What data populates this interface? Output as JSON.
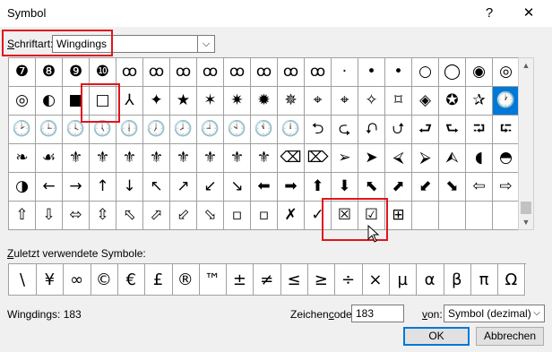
{
  "window": {
    "title": "Symbol",
    "help_label": "?",
    "close_label": "✕"
  },
  "font_row": {
    "label_underlined": "S",
    "label_rest": "chriftart:",
    "value": "Wingdings"
  },
  "grid_rows": [
    [
      "❼",
      "❽",
      "❾",
      "❿",
      "ꝏ",
      "ꝏ",
      "ꝏ",
      "ꝏ",
      "ꝏ",
      "ꝏ",
      "ꝏ",
      "ꝏ",
      "·",
      "•",
      "•",
      "○",
      "◯",
      "◉",
      "◎"
    ],
    [
      "◎",
      "◐",
      "■",
      "□",
      "⅄",
      "✦",
      "★",
      "✶",
      "✷",
      "✹",
      "✵",
      "⌖",
      "⌖",
      "✧",
      "⌑",
      "◈",
      "✪",
      "✰",
      "🕐"
    ],
    [
      "🕑",
      "🕒",
      "🕓",
      "🕔",
      "🕕",
      "🕖",
      "🕗",
      "🕘",
      "🕙",
      "🕚",
      "🕛",
      "⮌",
      "⮎",
      "⮏",
      "⮍",
      "⮐",
      "⮑",
      "⮒",
      "⮓"
    ],
    [
      "❧",
      "☙",
      "⚜",
      "⚜",
      "⚜",
      "⚜",
      "⚜",
      "⚜",
      "⚜",
      "⚜",
      "⌫",
      "⌦",
      "➢",
      "➤",
      "⮘",
      "⮚",
      "⮙",
      "◖",
      "◓"
    ],
    [
      "◑",
      "←",
      "→",
      "↑",
      "↓",
      "↖",
      "↗",
      "↙",
      "↘",
      "⬅",
      "➡",
      "⬆",
      "⬇",
      "⬉",
      "⬈",
      "⬋",
      "⬊",
      "⇦",
      "⇨"
    ],
    [
      "⇧",
      "⇩",
      "⬄",
      "⇳",
      "⬁",
      "⬀",
      "⬃",
      "⬂",
      "▫",
      "▫",
      "✗",
      "✓",
      "☒",
      "☑",
      "⊞",
      "",
      "",
      "",
      ""
    ]
  ],
  "selected_symbol_desc": "clock",
  "recent": {
    "label_underlined": "Z",
    "label_rest": "uletzt verwendete Symbole:",
    "symbols": [
      "\\",
      "¥",
      "∞",
      "©",
      "€",
      "£",
      "®",
      "™",
      "±",
      "≠",
      "≤",
      "≥",
      "÷",
      "×",
      "µ",
      "α",
      "β",
      "π",
      "Ω"
    ]
  },
  "status": "Wingdings: 183",
  "code": {
    "label_pre": "Zeichen",
    "label_underlined": "c",
    "label_post": "ode:",
    "value": "183"
  },
  "from": {
    "label_underlined": "v",
    "label_rest": "on:",
    "value": "Symbol (dezimal)"
  },
  "buttons": {
    "ok": "OK",
    "cancel": "Abbrechen"
  },
  "colors": {
    "highlight": "#e0151d",
    "selection": "#0078d7"
  }
}
